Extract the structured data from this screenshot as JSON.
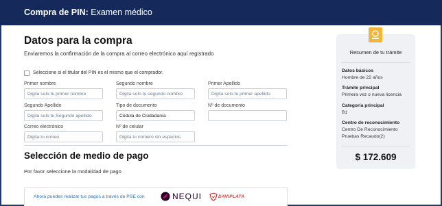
{
  "header": {
    "title_bold": "Compra de PIN:",
    "title_rest": " Examen médico"
  },
  "purchase": {
    "title": "Datos para la compra",
    "subtitle": "Enviaremos la confirmación de la compra al correo electrónico aquí registrado",
    "checkbox_label": "Seleccione si el titular del PIN es el mismo que el comprador.",
    "fields": {
      "first_name": {
        "label": "Primer nombre",
        "placeholder": "Digita solo tu primer nombre"
      },
      "second_name": {
        "label": "Segundo nombre",
        "placeholder": "Digita solo tu segundo nombre"
      },
      "first_surname": {
        "label": "Primer Apellido",
        "placeholder": "Digita solo tu primer apellido"
      },
      "second_surname": {
        "label": "Segundo Apellido",
        "placeholder": "Digita solo tu Segundo apellido"
      },
      "doc_type": {
        "label": "Tipo de documento",
        "value": "Cédula de Ciudadanía"
      },
      "doc_number": {
        "label": "Nº de documento",
        "value": ""
      },
      "email": {
        "label": "Correo electrónico",
        "placeholder": "Digita tu correo"
      },
      "phone": {
        "label": "Nº de celular",
        "placeholder": "Digita tu número sin espacios"
      }
    }
  },
  "payment": {
    "title": "Selección de medio de pago",
    "subtitle": "Por favor seleccione la modalidad de pago",
    "pse_text": "Ahora puedes realizar tus pagos a través de PSE con",
    "nequi": "NEQUI",
    "daviplata": "DAVIPLATA"
  },
  "summary": {
    "title": "Resumen de tu trámite",
    "basic_label": "Datos básicos",
    "basic_value": "Hombre de 22 años",
    "procedure_label": "Trámite principal",
    "procedure_value": "Primera vez o nueva licencia",
    "category_label": "Categoría principal",
    "category_value": "B1",
    "center_label": "Centro de reconocimiento",
    "center_value_1": "Centro De Reconocimiento",
    "center_value_2": "Pruebas Recaudo(2)",
    "price": "$ 172.609"
  },
  "colors": {
    "header_bg": "#15295a",
    "badge": "#f3b53b",
    "link_blue": "#2a6fb3",
    "davi_red": "#d33a3a"
  }
}
